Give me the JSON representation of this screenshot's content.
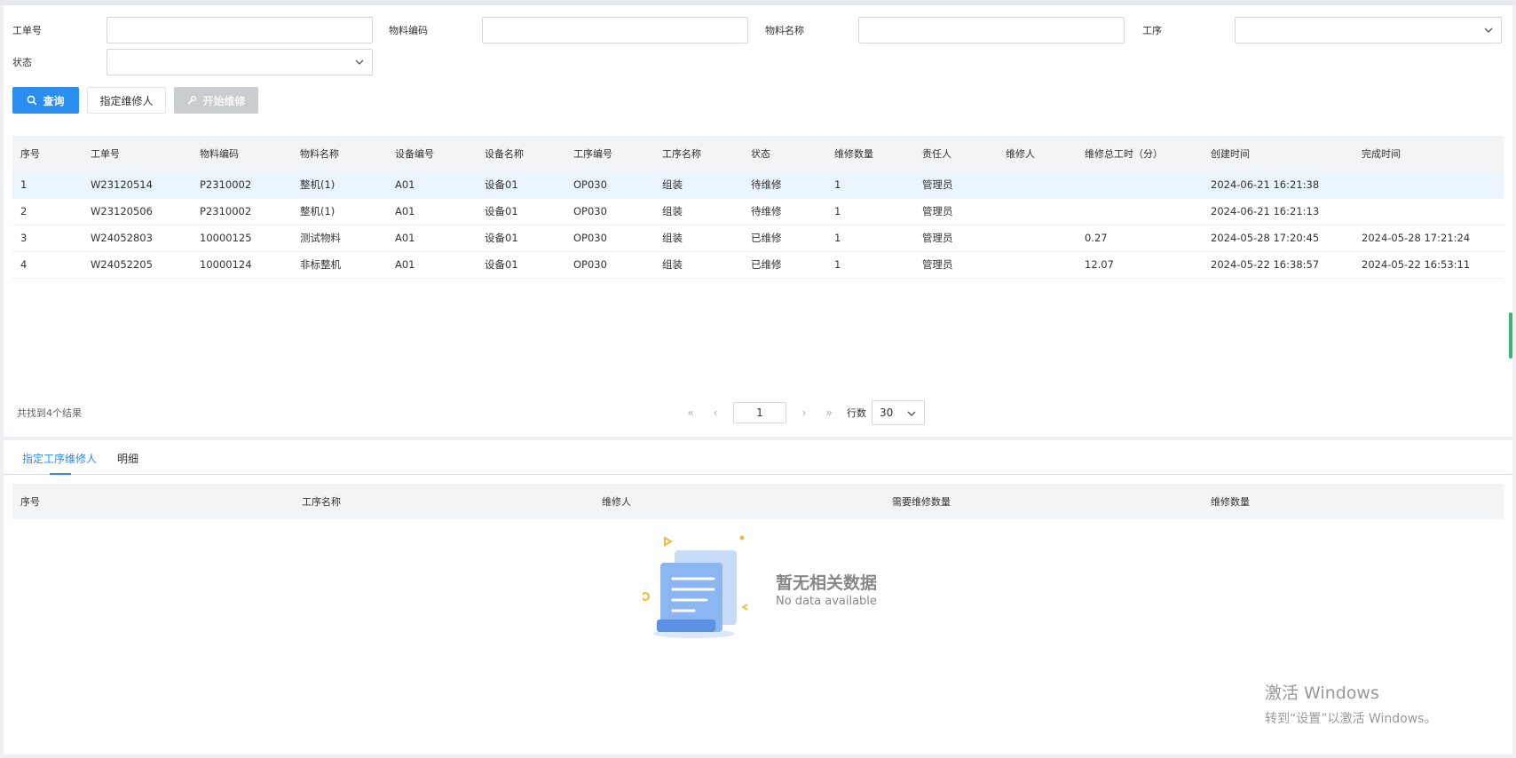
{
  "filters": {
    "order_no_label": "工单号",
    "material_code_label": "物料编码",
    "material_name_label": "物料名称",
    "process_label": "工序",
    "status_label": "状态",
    "order_no_value": "",
    "material_code_value": "",
    "material_name_value": "",
    "process_value": "",
    "status_value": ""
  },
  "buttons": {
    "query": "查询",
    "assign": "指定维修人",
    "start_repair": "开始维修"
  },
  "table": {
    "columns": [
      "序号",
      "工单号",
      "物料编码",
      "物料名称",
      "设备编号",
      "设备名称",
      "工序编号",
      "工序名称",
      "状态",
      "维修数量",
      "责任人",
      "维修人",
      "维修总工时（分）",
      "创建时间",
      "完成时间"
    ],
    "rows": [
      [
        "1",
        "W23120514",
        "P2310002",
        "整机(1)",
        "A01",
        "设备01",
        "OP030",
        "组装",
        "待维修",
        "1",
        "管理员",
        "",
        "",
        "2024-06-21 16:21:38",
        ""
      ],
      [
        "2",
        "W23120506",
        "P2310002",
        "整机(1)",
        "A01",
        "设备01",
        "OP030",
        "组装",
        "待维修",
        "1",
        "管理员",
        "",
        "",
        "2024-06-21 16:21:13",
        ""
      ],
      [
        "3",
        "W24052803",
        "10000125",
        "测试物料",
        "A01",
        "设备01",
        "OP030",
        "组装",
        "已维修",
        "1",
        "管理员",
        "",
        "0.27",
        "2024-05-28 17:20:45",
        "2024-05-28 17:21:24"
      ],
      [
        "4",
        "W24052205",
        "10000124",
        "非标整机",
        "A01",
        "设备01",
        "OP030",
        "组装",
        "已维修",
        "1",
        "管理员",
        "",
        "12.07",
        "2024-05-22 16:38:57",
        "2024-05-22 16:53:11"
      ]
    ],
    "result_count": "共找到4个结果"
  },
  "pager": {
    "page": "1",
    "rows_label": "行数",
    "page_size": "30"
  },
  "detail": {
    "tabs": [
      "指定工序维修人",
      "明细"
    ],
    "columns": [
      "序号",
      "工序名称",
      "维修人",
      "需要维修数量",
      "维修数量"
    ],
    "empty_title": "暂无相关数据",
    "empty_sub": "No data available"
  },
  "watermark": {
    "line1": "激活 Windows",
    "line2": "转到“设置”以激活 Windows。"
  },
  "colors": {
    "accent": "#2a8df0",
    "selected_row": "#eaf4fd",
    "header_bg": "#f3f4f6"
  }
}
